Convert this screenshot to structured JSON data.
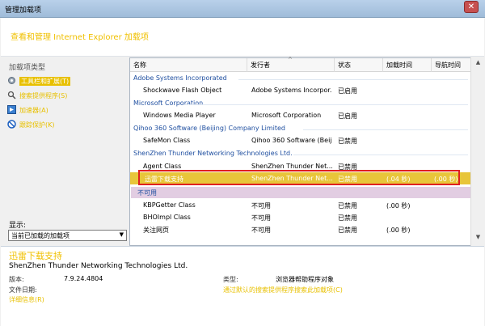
{
  "window": {
    "title": "管理加载项",
    "close_glyph": "✕"
  },
  "header": {
    "headline": "查看和管理 Internet Explorer 加载项"
  },
  "sidebar": {
    "category_label": "加载项类型",
    "items": [
      {
        "label": "工具栏和扩展(T)",
        "icon": "gear-icon",
        "selected": true
      },
      {
        "label": "搜索提供程序(S)",
        "icon": "search-icon",
        "selected": false
      },
      {
        "label": "加速器(A)",
        "icon": "accelerator-icon",
        "selected": false
      },
      {
        "label": "跟踪保护(K)",
        "icon": "tracking-protection-icon",
        "selected": false
      }
    ],
    "show_label": "显示:",
    "show_value": "当前已加载的加载项"
  },
  "table": {
    "columns": [
      "名称",
      "发行者",
      "状态",
      "加载时间",
      "导航时间"
    ],
    "groups": [
      {
        "name": "Adobe Systems Incorporated",
        "rows": [
          {
            "name": "Shockwave Flash Object",
            "publisher": "Adobe Systems Incorpor...",
            "status": "已启用",
            "load": "",
            "nav": ""
          }
        ]
      },
      {
        "name": "Microsoft Corporation",
        "rows": [
          {
            "name": "Windows Media Player",
            "publisher": "Microsoft Corporation",
            "status": "已启用",
            "load": "",
            "nav": ""
          }
        ]
      },
      {
        "name": "Qihoo 360 Software (Beijing) Company Limited",
        "rows": [
          {
            "name": "SafeMon Class",
            "publisher": "Qihoo 360 Software (Beij...",
            "status": "已禁用",
            "load": "",
            "nav": ""
          }
        ]
      },
      {
        "name": "ShenZhen Thunder Networking Technologies Ltd.",
        "rows": [
          {
            "name": "Agent Class",
            "publisher": "ShenZhen Thunder Net...",
            "status": "已禁用",
            "load": "",
            "nav": ""
          },
          {
            "name": "迅雷下载支持",
            "publisher": "ShenZhen Thunder Net...",
            "status": "已禁用",
            "load": "(.04 秒)",
            "nav": "(.00 秒)"
          }
        ]
      },
      {
        "name": "不可用",
        "rows": [
          {
            "name": "KBPGetter Class",
            "publisher": "不可用",
            "status": "已禁用",
            "load": "(.00 秒)",
            "nav": ""
          },
          {
            "name": "BHOImpl Class",
            "publisher": "不可用",
            "status": "已禁用",
            "load": "",
            "nav": ""
          },
          {
            "name": "关注网页",
            "publisher": "不可用",
            "status": "已禁用",
            "load": "(.00 秒)",
            "nav": ""
          }
        ]
      }
    ]
  },
  "details": {
    "addon_name": "迅雷下载支持",
    "publisher": "ShenZhen Thunder Networking Technologies Ltd.",
    "version_label": "版本:",
    "version_value": "7.9.24.4804",
    "date_label": "文件日期:",
    "more_info_link": "详细信息(R)",
    "type_label": "类型:",
    "type_value": "浏览器帮助程序对象",
    "search_link": "通过默认的搜索提供程序搜索此加载项(C)"
  },
  "colors": {
    "accent_yellow": "#e8c000",
    "selection": "#e8c53a",
    "group_blue": "#1f4fa0",
    "highlight_red": "#e02020"
  }
}
